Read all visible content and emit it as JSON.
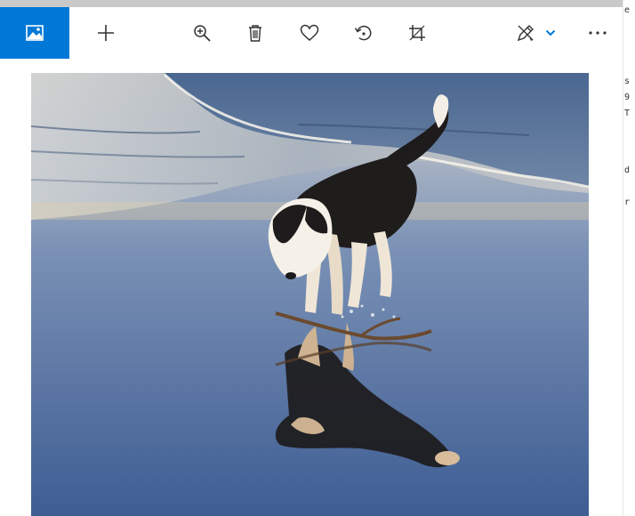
{
  "app": {
    "toolbar": {
      "buttons": [
        {
          "name": "view-photo-button",
          "icon": "image-icon"
        },
        {
          "name": "add-button",
          "icon": "plus-icon"
        },
        {
          "name": "zoom-button",
          "icon": "zoom-in-icon"
        },
        {
          "name": "delete-button",
          "icon": "trash-icon"
        },
        {
          "name": "favorite-button",
          "icon": "heart-icon"
        },
        {
          "name": "rotate-button",
          "icon": "rotate-icon"
        },
        {
          "name": "crop-button",
          "icon": "crop-icon"
        },
        {
          "name": "edit-create-button",
          "icon": "pen-edit-icon"
        },
        {
          "name": "edit-dropdown-button",
          "icon": "chevron-down-icon"
        },
        {
          "name": "more-options-button",
          "icon": "more-horizontal-icon"
        }
      ],
      "more_label": "···"
    },
    "photo": {
      "subject": "dog-on-beach-photo"
    },
    "colors": {
      "accent": "#0078d7",
      "toolbar_bg": "#ffffff",
      "icon": "#333333"
    },
    "right_edge_fragments": [
      "e",
      "s",
      "9",
      "T",
      "d",
      "r"
    ]
  }
}
